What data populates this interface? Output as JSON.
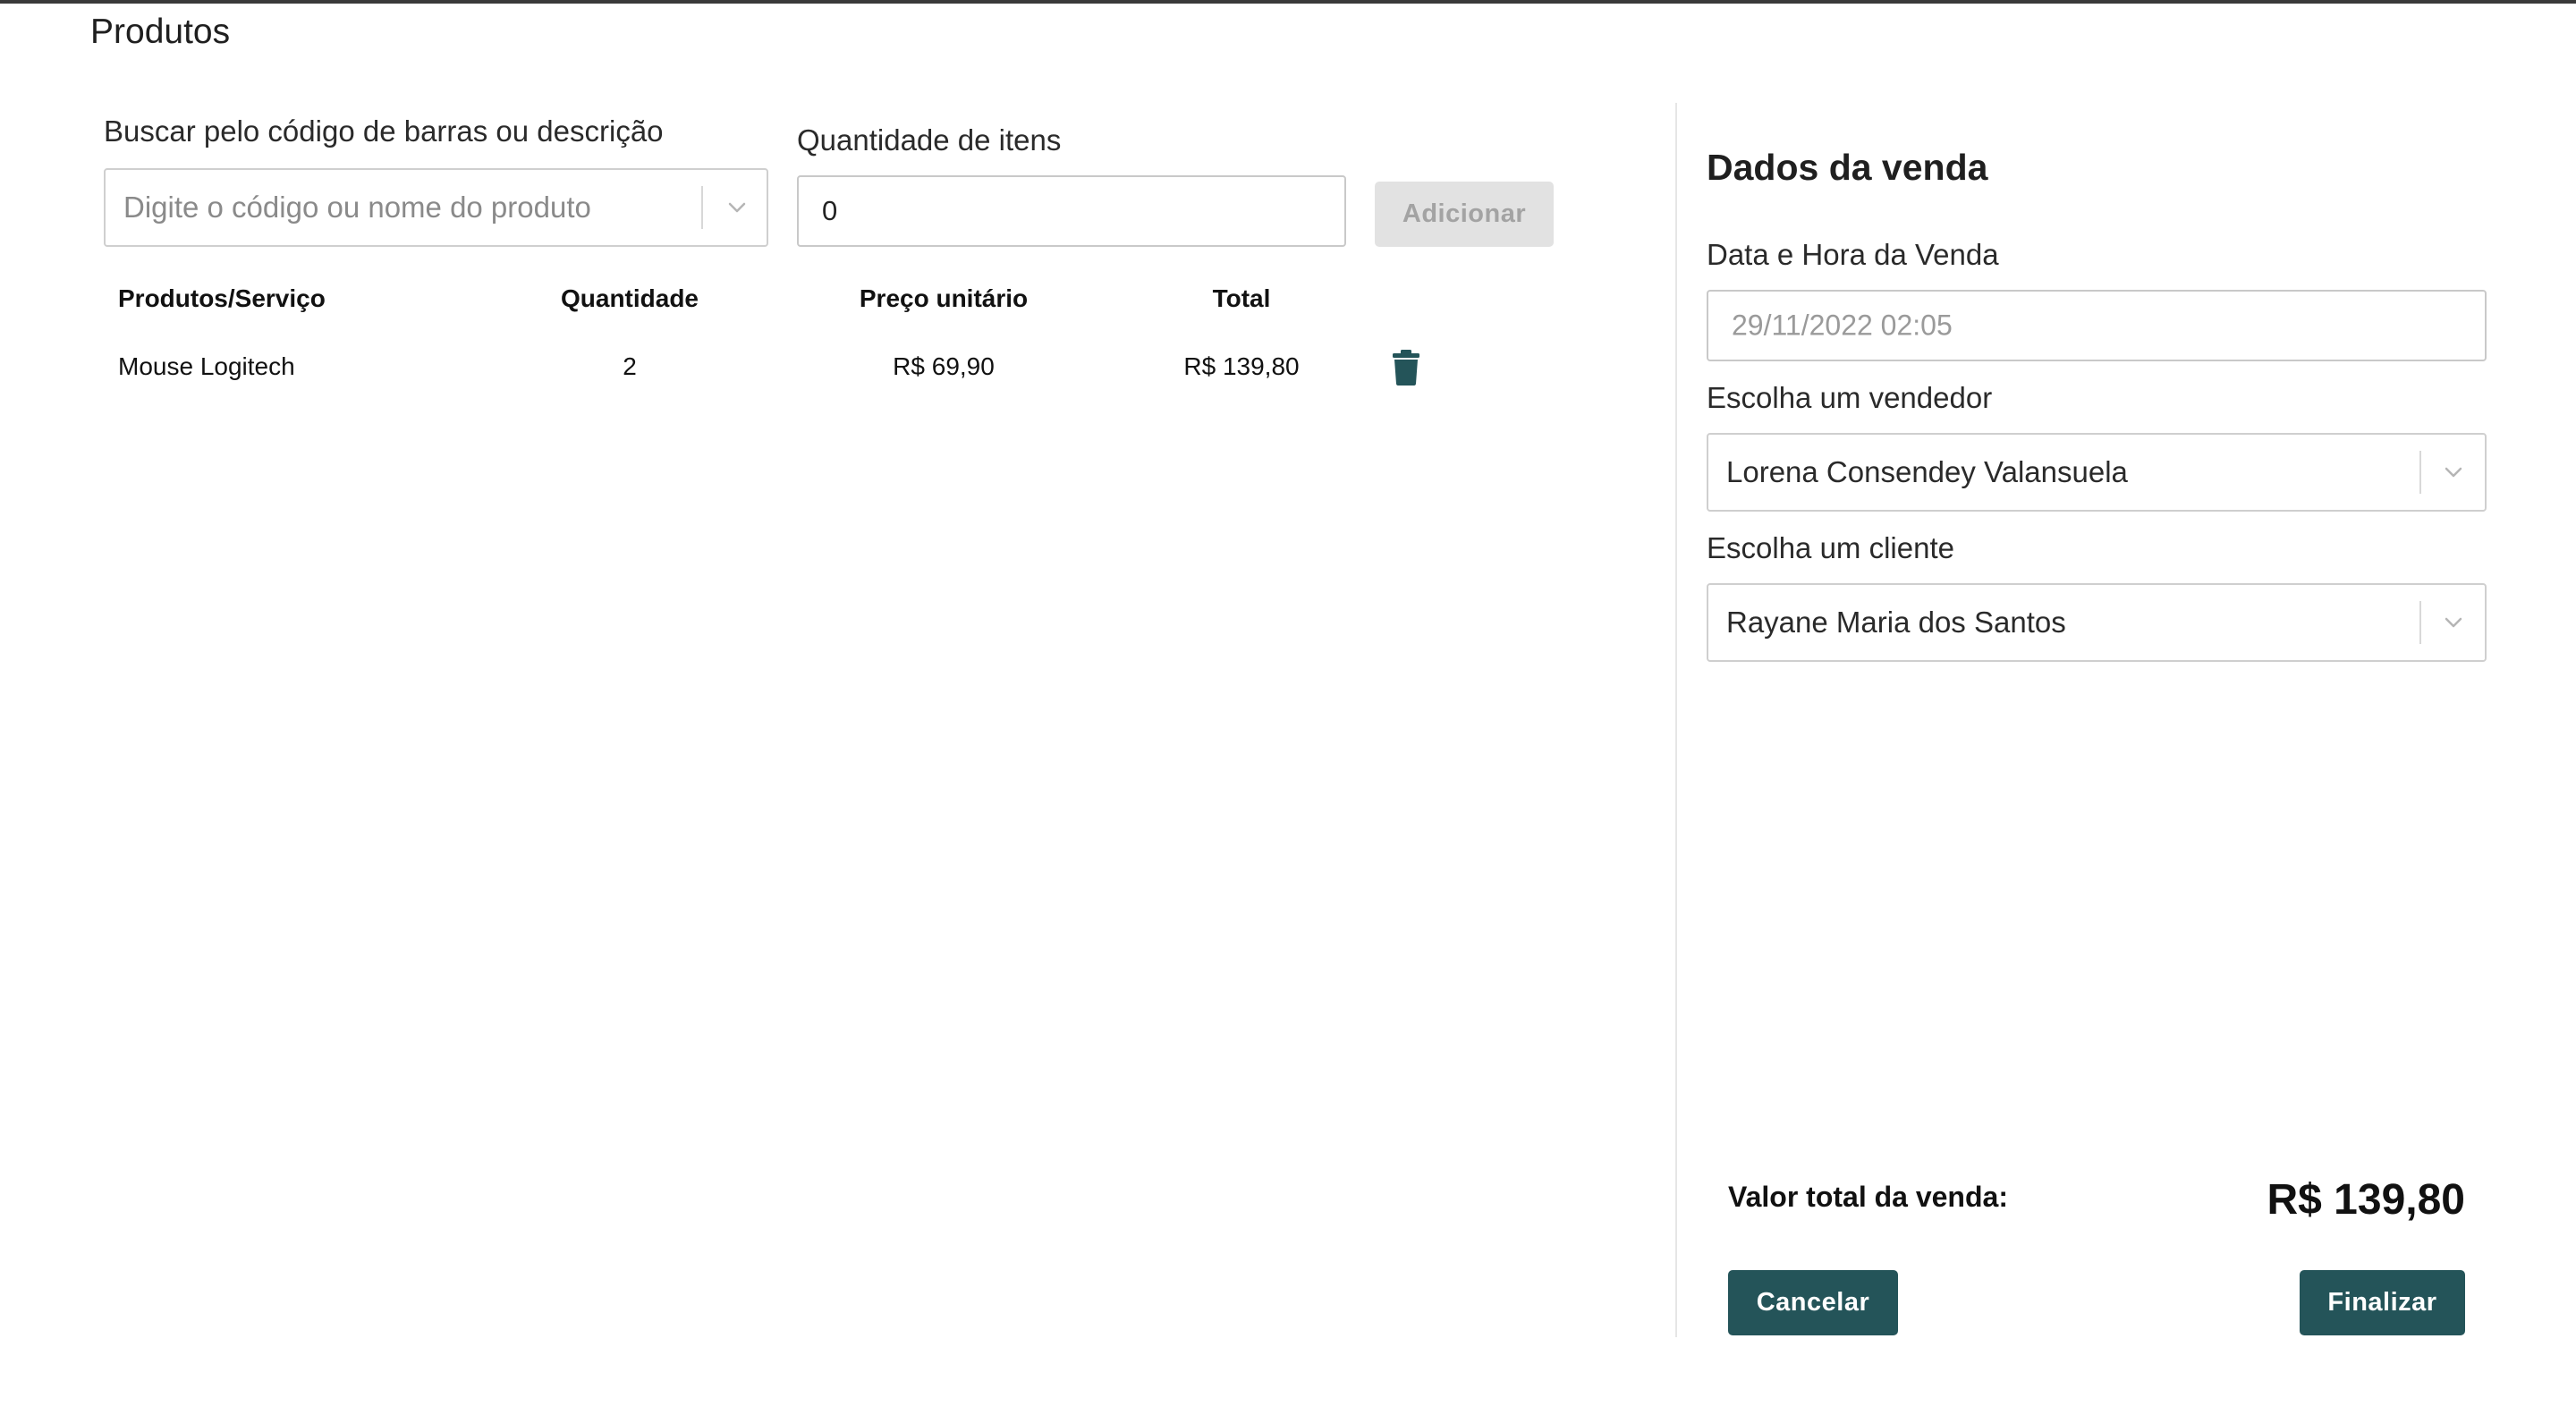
{
  "page": {
    "title": "Produtos"
  },
  "search": {
    "label": "Buscar pelo código de barras ou descrição",
    "placeholder": "Digite o código ou nome do produto"
  },
  "quantity": {
    "label": "Quantidade de itens",
    "value": "0"
  },
  "add_button": {
    "label": "Adicionar"
  },
  "table": {
    "headers": [
      "Produtos/Serviço",
      "Quantidade",
      "Preço unitário",
      "Total"
    ],
    "rows": [
      {
        "product": "Mouse Logitech",
        "quantity": "2",
        "unit_price": "R$ 69,90",
        "total": "R$ 139,80"
      }
    ],
    "delete_icon": "trash-icon"
  },
  "sale": {
    "title": "Dados da venda",
    "datetime": {
      "label": "Data e Hora da Venda",
      "value": "29/11/2022 02:05"
    },
    "seller": {
      "label": "Escolha um vendedor",
      "value": "Lorena Consendey Valansuela"
    },
    "client": {
      "label": "Escolha um cliente",
      "value": "Rayane Maria dos Santos"
    },
    "total_label": "Valor total da venda:",
    "total_value": "R$ 139,80",
    "cancel_label": "Cancelar",
    "finish_label": "Finalizar"
  },
  "colors": {
    "primary": "#245459",
    "disabled_button_bg": "#e2e2e2",
    "disabled_button_text": "#a3a3a3",
    "border": "#cfcfcf"
  }
}
